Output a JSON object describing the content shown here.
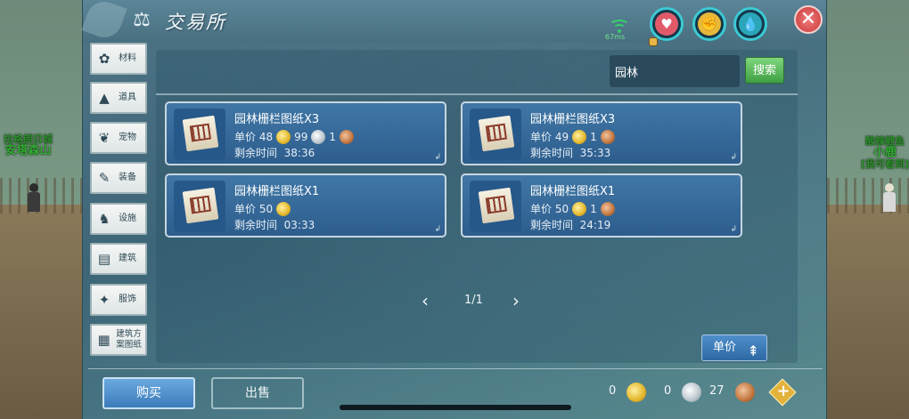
{
  "window": {
    "title": "交易所",
    "ping": "67ms"
  },
  "world": {
    "left_label_small": "拉格朗日城",
    "left_label_big": "安塔森山",
    "right_label_top": "酸辣鲤鱼",
    "right_label_big": "小鹿",
    "right_label_sub": "[我可看到]"
  },
  "sidebar": {
    "items": [
      {
        "label": "材料",
        "icon": "materials-icon"
      },
      {
        "label": "道具",
        "icon": "props-icon"
      },
      {
        "label": "宠物",
        "icon": "pet-paw-icon"
      },
      {
        "label": "装备",
        "icon": "equipment-icon"
      },
      {
        "label": "设施",
        "icon": "facility-icon"
      },
      {
        "label": "建筑",
        "icon": "building-icon"
      },
      {
        "label": "服饰",
        "icon": "clothing-icon"
      },
      {
        "label": "建筑方案图纸",
        "icon": "blueprint-icon"
      }
    ]
  },
  "search": {
    "value": "园林",
    "button_label": "搜索"
  },
  "listings": [
    {
      "name": "园林栅栏图纸X3",
      "price_label": "单价",
      "gold": "48",
      "silver": "99",
      "copper": "1",
      "time_label": "剩余时间",
      "time": "38:36"
    },
    {
      "name": "园林栅栏图纸X3",
      "price_label": "单价",
      "gold": "49",
      "copper": "1",
      "time_label": "剩余时间",
      "time": "35:33"
    },
    {
      "name": "园林栅栏图纸X1",
      "price_label": "单价",
      "gold": "50",
      "time_label": "剩余时间",
      "time": "03:33"
    },
    {
      "name": "园林栅栏图纸X1",
      "price_label": "单价",
      "gold": "50",
      "copper": "1",
      "time_label": "剩余时间",
      "time": "24:19"
    }
  ],
  "pager": {
    "text": "1/1"
  },
  "sort": {
    "label": "单价"
  },
  "footer": {
    "buy_label": "购买",
    "sell_label": "出售",
    "gold": "0",
    "silver": "0",
    "copper": "27"
  },
  "colors": {
    "accent": "#3ccad4",
    "buy": "#3c7bbb",
    "search": "#3f9f43"
  }
}
